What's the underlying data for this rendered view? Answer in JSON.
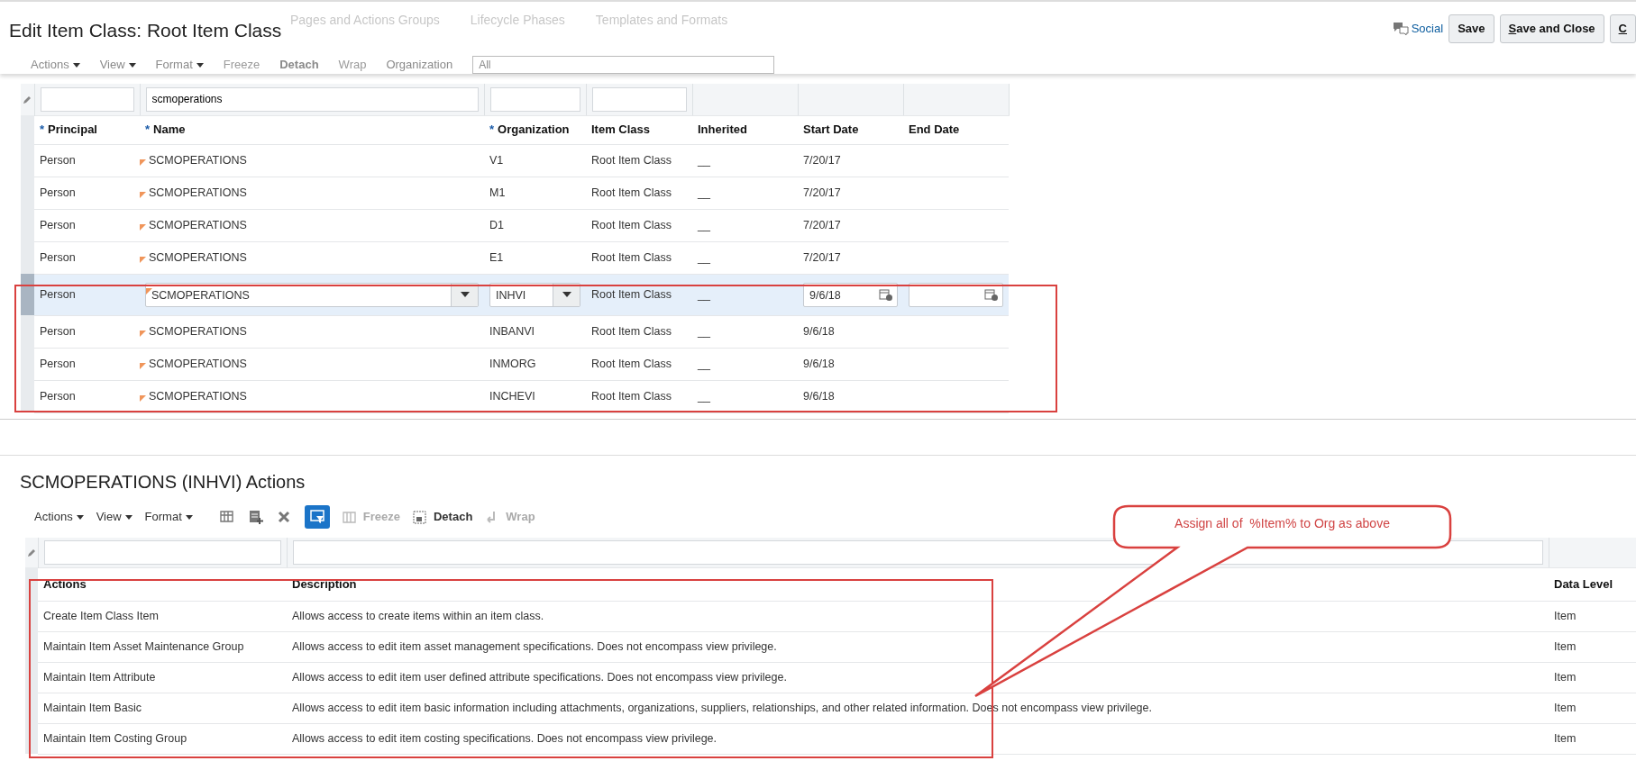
{
  "header": {
    "title": "Edit Item Class: Root Item Class",
    "social": "Social",
    "buttons": [
      {
        "label": "Save",
        "mnemonic": false
      },
      {
        "label": "Save and Close",
        "mnemonic": true
      },
      {
        "label": "C",
        "mnemonic": true
      }
    ]
  },
  "background_tabs": [
    "Pages and Actions Groups",
    "Lifecycle Phases",
    "Templates and Formats"
  ],
  "background_toolbar": {
    "menus": [
      "Actions",
      "View",
      "Format"
    ],
    "tools": [
      {
        "label": "Freeze",
        "disabled": true
      },
      {
        "label": "Detach",
        "disabled": false
      },
      {
        "label": "Wrap",
        "disabled": true
      }
    ],
    "org_label": "Organization",
    "org_value": "All"
  },
  "security_table": {
    "filters": {
      "name": "scmoperations"
    },
    "columns": [
      {
        "label": "Principal",
        "required_mark": "*"
      },
      {
        "label": "Name",
        "required_mark": "*"
      },
      {
        "label": "Organization",
        "required_mark": "*"
      },
      {
        "label": "Item Class"
      },
      {
        "label": "Inherited"
      },
      {
        "label": "Start Date"
      },
      {
        "label": "End Date"
      }
    ],
    "rows": [
      {
        "principal": "Person",
        "name": "SCMOPERATIONS",
        "organization": "V1",
        "item_class": "Root Item Class",
        "inherited": "__",
        "start_date": "7/20/17",
        "selected": false
      },
      {
        "principal": "Person",
        "name": "SCMOPERATIONS",
        "organization": "M1",
        "item_class": "Root Item Class",
        "inherited": "__",
        "start_date": "7/20/17",
        "selected": false
      },
      {
        "principal": "Person",
        "name": "SCMOPERATIONS",
        "organization": "D1",
        "item_class": "Root Item Class",
        "inherited": "__",
        "start_date": "7/20/17",
        "selected": false
      },
      {
        "principal": "Person",
        "name": "SCMOPERATIONS",
        "organization": "E1",
        "item_class": "Root Item Class",
        "inherited": "__",
        "start_date": "7/20/17",
        "selected": false
      },
      {
        "principal": "Person",
        "name": "SCMOPERATIONS",
        "organization": "INHVI",
        "item_class": "Root Item Class",
        "inherited": "__",
        "start_date": "9/6/18",
        "selected": true
      },
      {
        "principal": "Person",
        "name": "SCMOPERATIONS",
        "organization": "INBANVI",
        "item_class": "Root Item Class",
        "inherited": "__",
        "start_date": "9/6/18",
        "selected": false
      },
      {
        "principal": "Person",
        "name": "SCMOPERATIONS",
        "organization": "INMORG",
        "item_class": "Root Item Class",
        "inherited": "__",
        "start_date": "9/6/18",
        "selected": false
      },
      {
        "principal": "Person",
        "name": "SCMOPERATIONS",
        "organization": "INCHEVI",
        "item_class": "Root Item Class",
        "inherited": "__",
        "start_date": "9/6/18",
        "selected": false
      }
    ]
  },
  "actions_section": {
    "title": "SCMOPERATIONS (INHVI) Actions",
    "toolbar": {
      "menus": [
        "Actions",
        "View",
        "Format"
      ],
      "query_by_example": true,
      "tools": [
        {
          "label": "Freeze",
          "disabled": true
        },
        {
          "label": "Detach",
          "disabled": false
        },
        {
          "label": "Wrap",
          "disabled": true
        }
      ]
    },
    "columns": [
      "Actions",
      "Description",
      "Data Level"
    ],
    "rows": [
      {
        "action": "Create Item Class Item",
        "description": "Allows access to create items within an item class.",
        "data_level": "Item"
      },
      {
        "action": "Maintain Item Asset Maintenance Group",
        "description": "Allows access to edit item asset management specifications. Does not encompass view privilege.",
        "data_level": "Item"
      },
      {
        "action": "Maintain Item Attribute",
        "description": "Allows access to edit item user defined attribute specifications. Does not encompass view privilege.",
        "data_level": "Item"
      },
      {
        "action": "Maintain Item Basic",
        "description": "Allows access to edit item basic information including attachments, organizations, suppliers, relationships, and other related information. Does not encompass view privilege.",
        "data_level": "Item"
      },
      {
        "action": "Maintain Item Costing Group",
        "description": "Allows access to edit item costing specifications. Does not encompass view privilege.",
        "data_level": "Item"
      }
    ]
  },
  "callout": {
    "text": "Assign all of  %Item% to Org as above"
  }
}
